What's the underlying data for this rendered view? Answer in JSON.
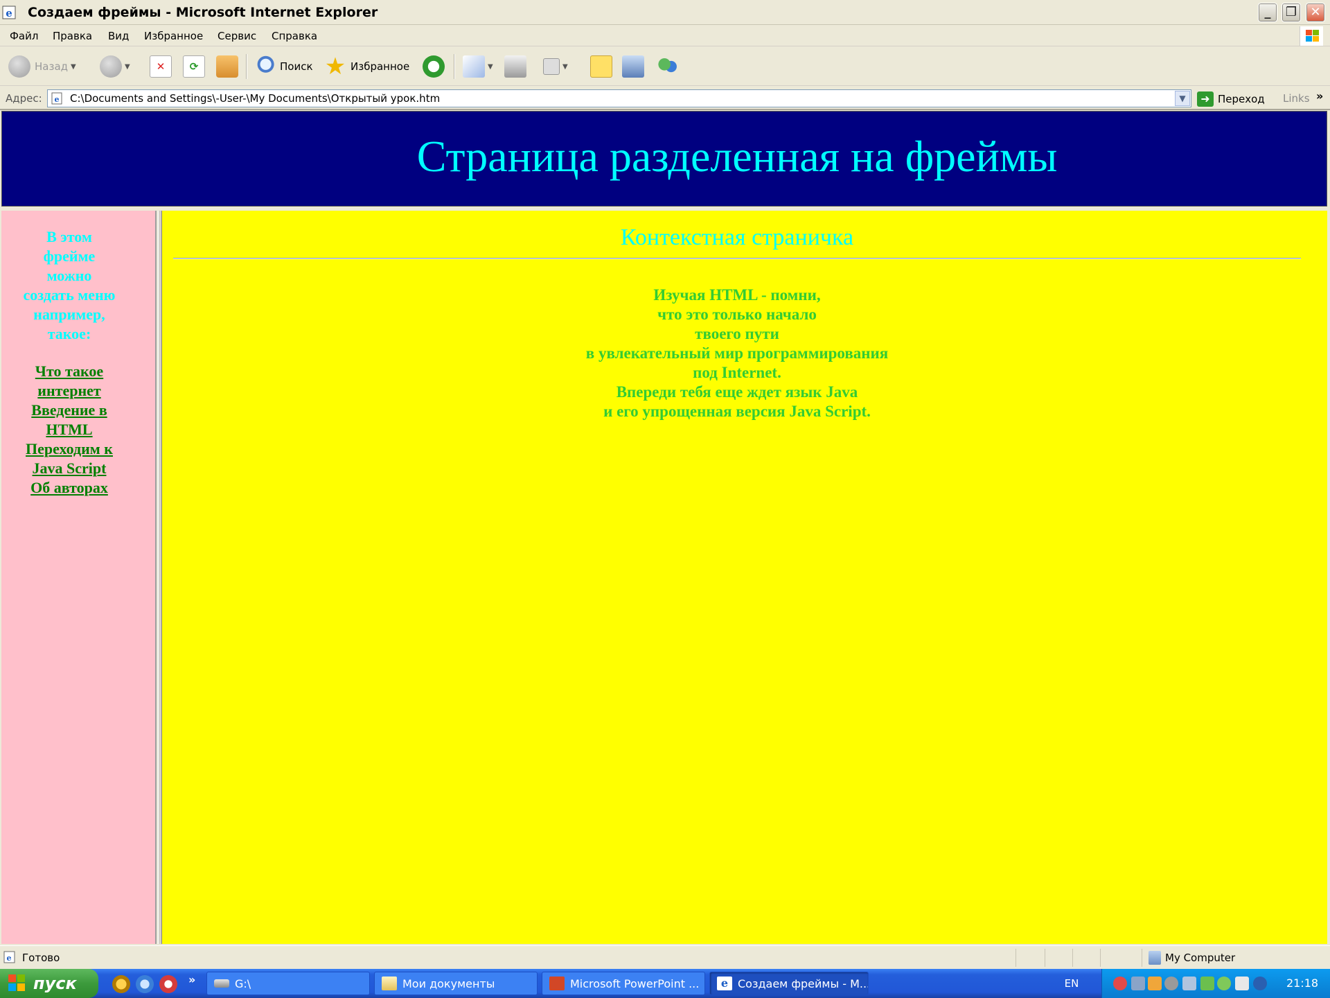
{
  "window": {
    "title": "Создаем фреймы - Microsoft Internet Explorer",
    "controls": {
      "minimize": "_",
      "maximize": "❐",
      "close": "✕"
    }
  },
  "menu": [
    "Файл",
    "Правка",
    "Вид",
    "Избранное",
    "Сервис",
    "Справка"
  ],
  "toolbar": {
    "back": "Назад",
    "search": "Поиск",
    "favorites": "Избранное"
  },
  "address": {
    "label": "Адрес:",
    "url": "C:\\Documents and Settings\\-User-\\My Documents\\Открытый урок.htm",
    "go": "Переход",
    "links": "Links",
    "more": "»"
  },
  "page": {
    "banner": "Страница разделенная на фреймы",
    "left_intro": [
      "В этом",
      "фрейме",
      "можно",
      "создать меню",
      "например,",
      "такое:"
    ],
    "left_links": [
      "Что такое",
      "интернет",
      "Введение в",
      "HTML",
      "Переходим к",
      "Java Script",
      "Об авторах"
    ],
    "subtitle": "Контекстная страничка",
    "verse": [
      "Изучая HTML - помни,",
      "что это только начало",
      "твоего пути",
      "в увлекательный мир программирования",
      "под Internet.",
      "Впереди тебя еще ждет язык Java",
      "и его упрощенная версия Java Script."
    ],
    "colors": {
      "banner_bg": "#000080",
      "heading_text": "#00FFFF",
      "left_bg": "#FFC0CB",
      "main_bg": "#FFFF00",
      "link": "#008000",
      "verse": "#33CC33"
    }
  },
  "status": {
    "text": "Готово",
    "zone": "My Computer"
  },
  "taskbar": {
    "start": "пуск",
    "more": "»",
    "tasks": [
      "G:\\",
      "Мои документы",
      "Microsoft PowerPoint ...",
      "Создаем фреймы - M..."
    ],
    "lang": "EN",
    "clock": "21:18"
  },
  "icons": [
    "ie-icon",
    "back-icon",
    "forward-icon",
    "stop-icon",
    "refresh-icon",
    "home-icon",
    "search-icon",
    "favorites-star-icon",
    "history-icon",
    "mail-icon",
    "print-icon",
    "edit-icon",
    "notes-icon",
    "research-icon",
    "messenger-icon",
    "windows-flag-icon"
  ]
}
